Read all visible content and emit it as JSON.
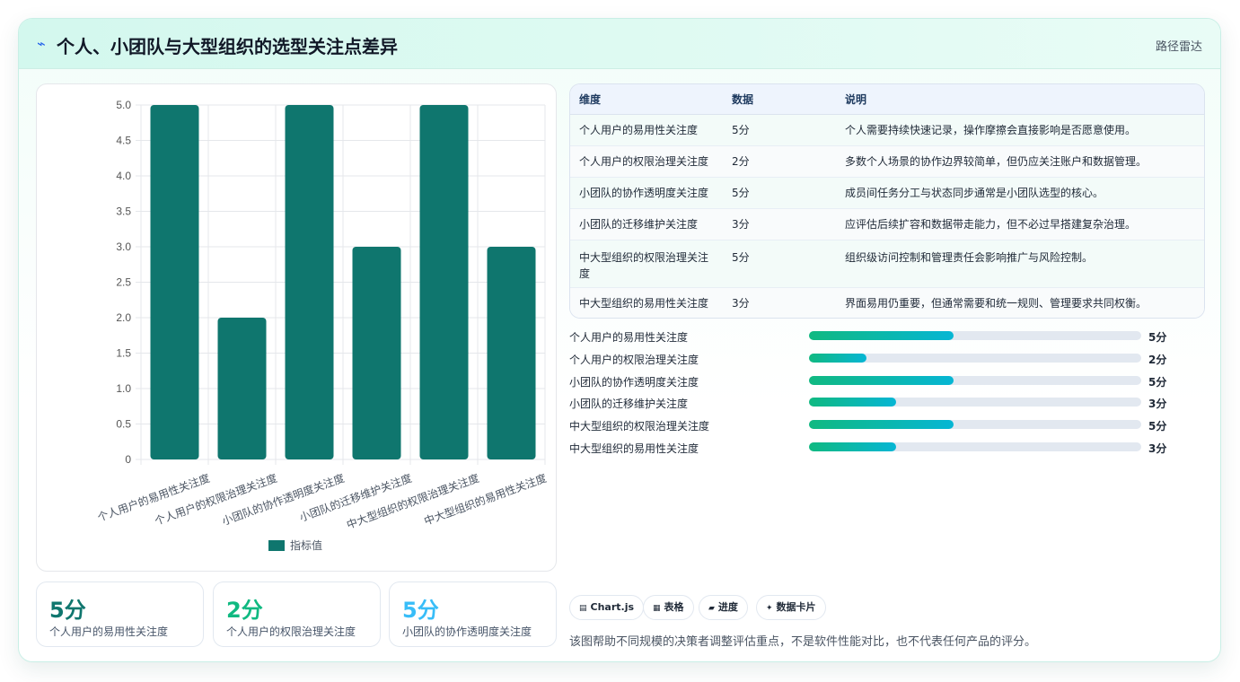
{
  "header": {
    "title": "个人、小团队与大型组织的选型关注点差异",
    "right_label": "路径雷达",
    "icon": "lightning-icon"
  },
  "chart_data": {
    "type": "bar",
    "categories": [
      "个人用户的易用性关注度",
      "个人用户的权限治理关注度",
      "小团队的协作透明度关注度",
      "小团队的迁移维护关注度",
      "中大型组织的权限治理关注度",
      "中大型组织的易用性关注度"
    ],
    "series": [
      {
        "name": "指标值",
        "values": [
          5,
          2,
          5,
          3,
          5,
          3
        ]
      }
    ],
    "ylim": [
      0,
      5
    ],
    "yticks": [
      "0",
      "0.5",
      "1.0",
      "1.5",
      "2.0",
      "2.5",
      "3.0",
      "3.5",
      "4.0",
      "4.5",
      "5.0"
    ],
    "grid": true,
    "legend": "bottom",
    "color": "#0f766e"
  },
  "stats": [
    {
      "value": "5分",
      "label": "个人用户的易用性关注度",
      "color": "#0f766e"
    },
    {
      "value": "2分",
      "label": "个人用户的权限治理关注度",
      "color": "#10b981"
    },
    {
      "value": "5分",
      "label": "小团队的协作透明度关注度",
      "color": "#38bdf8"
    }
  ],
  "table": {
    "headers": [
      "维度",
      "数据",
      "说明"
    ],
    "rows": [
      {
        "dim": "个人用户的易用性关注度",
        "val": "5分",
        "desc": "个人需要持续快速记录，操作摩擦会直接影响是否愿意使用。"
      },
      {
        "dim": "个人用户的权限治理关注度",
        "val": "2分",
        "desc": "多数个人场景的协作边界较简单，但仍应关注账户和数据管理。"
      },
      {
        "dim": "小团队的协作透明度关注度",
        "val": "5分",
        "desc": "成员间任务分工与状态同步通常是小团队选型的核心。"
      },
      {
        "dim": "小团队的迁移维护关注度",
        "val": "3分",
        "desc": "应评估后续扩容和数据带走能力，但不必过早搭建复杂治理。"
      },
      {
        "dim": "中大型组织的权限治理关注度",
        "val": "5分",
        "desc": "组织级访问控制和管理责任会影响推广与风险控制。"
      },
      {
        "dim": "中大型组织的易用性关注度",
        "val": "3分",
        "desc": "界面易用仍重要，但通常需要和统一规则、管理要求共同权衡。"
      }
    ]
  },
  "progress": [
    {
      "name": "个人用户的易用性关注度",
      "value": 5,
      "label": "5分"
    },
    {
      "name": "个人用户的权限治理关注度",
      "value": 2,
      "label": "2分"
    },
    {
      "name": "小团队的协作透明度关注度",
      "value": 5,
      "label": "5分"
    },
    {
      "name": "小团队的迁移维护关注度",
      "value": 3,
      "label": "3分"
    },
    {
      "name": "中大型组织的权限治理关注度",
      "value": 5,
      "label": "5分"
    },
    {
      "name": "中大型组织的易用性关注度",
      "value": 3,
      "label": "3分"
    }
  ],
  "progress_max": 11.5,
  "chips": [
    {
      "icon": "chart-icon",
      "glyph": "▤",
      "label": "Chart.js"
    },
    {
      "icon": "table-icon",
      "glyph": "▦",
      "label": "表格"
    },
    {
      "icon": "progress-icon",
      "glyph": "▰",
      "label": "进度"
    },
    {
      "icon": "sparkle-icon",
      "glyph": "✦",
      "label": "数据卡片"
    }
  ],
  "footnote": "该图帮助不同规模的决策者调整评估重点，不是软件性能对比，也不代表任何产品的评分。"
}
